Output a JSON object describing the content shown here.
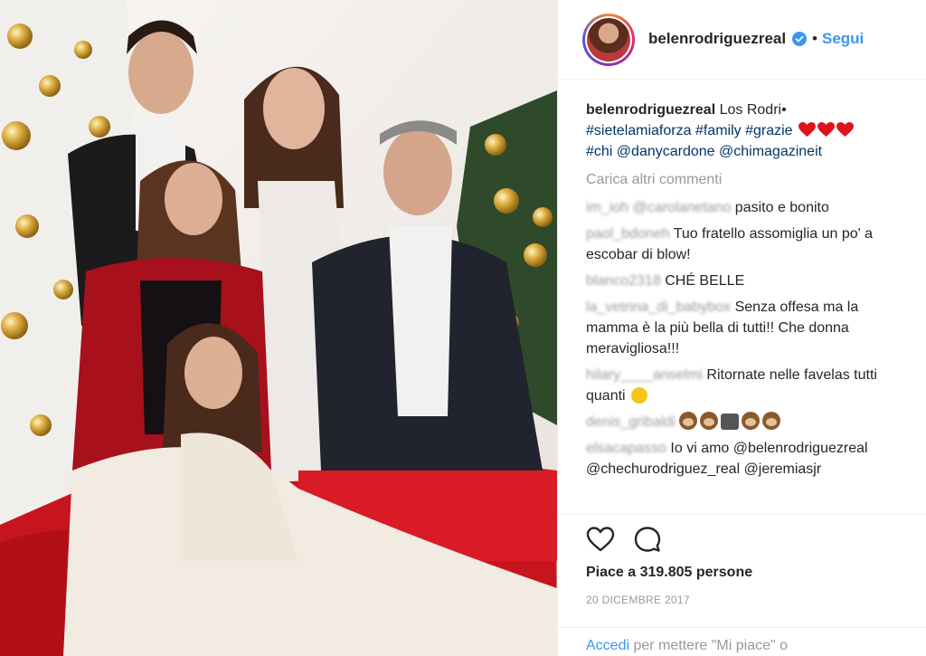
{
  "post": {
    "username": "belenrodriguezreal",
    "follow_dot": "•",
    "follow_label": "Segui",
    "caption": {
      "username": "belenrodriguezreal",
      "text": "Los Rodri•",
      "tags_line1": "#sietelamiaforza #family #grazie",
      "tags_line2": "#chi @danycardone @chimagazineit"
    },
    "load_more": "Carica altri commenti",
    "comments": [
      {
        "user": "im_ioh @carolanetano",
        "text": "pasito e bonito"
      },
      {
        "user": "paol_bdoneh",
        "text": "Tuo fratello assomiglia un po' a escobar di blow!"
      },
      {
        "user": "blanco2318",
        "text": "CHÉ BELLE"
      },
      {
        "user": "la_vetrina_di_babybox",
        "text": "Senza offesa ma la mamma è la più bella di tutti!! Che donna meravigliosa!!!"
      },
      {
        "user": "hilary____anselmi",
        "text": "Ritornate nelle favelas tutti quanti"
      },
      {
        "user": "denis_gribaldi",
        "text": ""
      },
      {
        "user": "elsacapasso",
        "text": "Io vi amo @belenrodriguezreal @chechurodriguez_real @jeremiasjr"
      }
    ],
    "likes": "Piace a 319.805 persone",
    "date": "20 DICEMBRE 2017",
    "login_link": "Accedi",
    "login_text": "per mettere \"Mi piace\" o"
  },
  "icons": {
    "heart": "heart-icon",
    "comment": "comment-icon",
    "verified": "verified-badge-icon"
  },
  "colors": {
    "link": "#3897f0",
    "tag": "#003569",
    "muted": "#999999",
    "text": "#262626"
  }
}
